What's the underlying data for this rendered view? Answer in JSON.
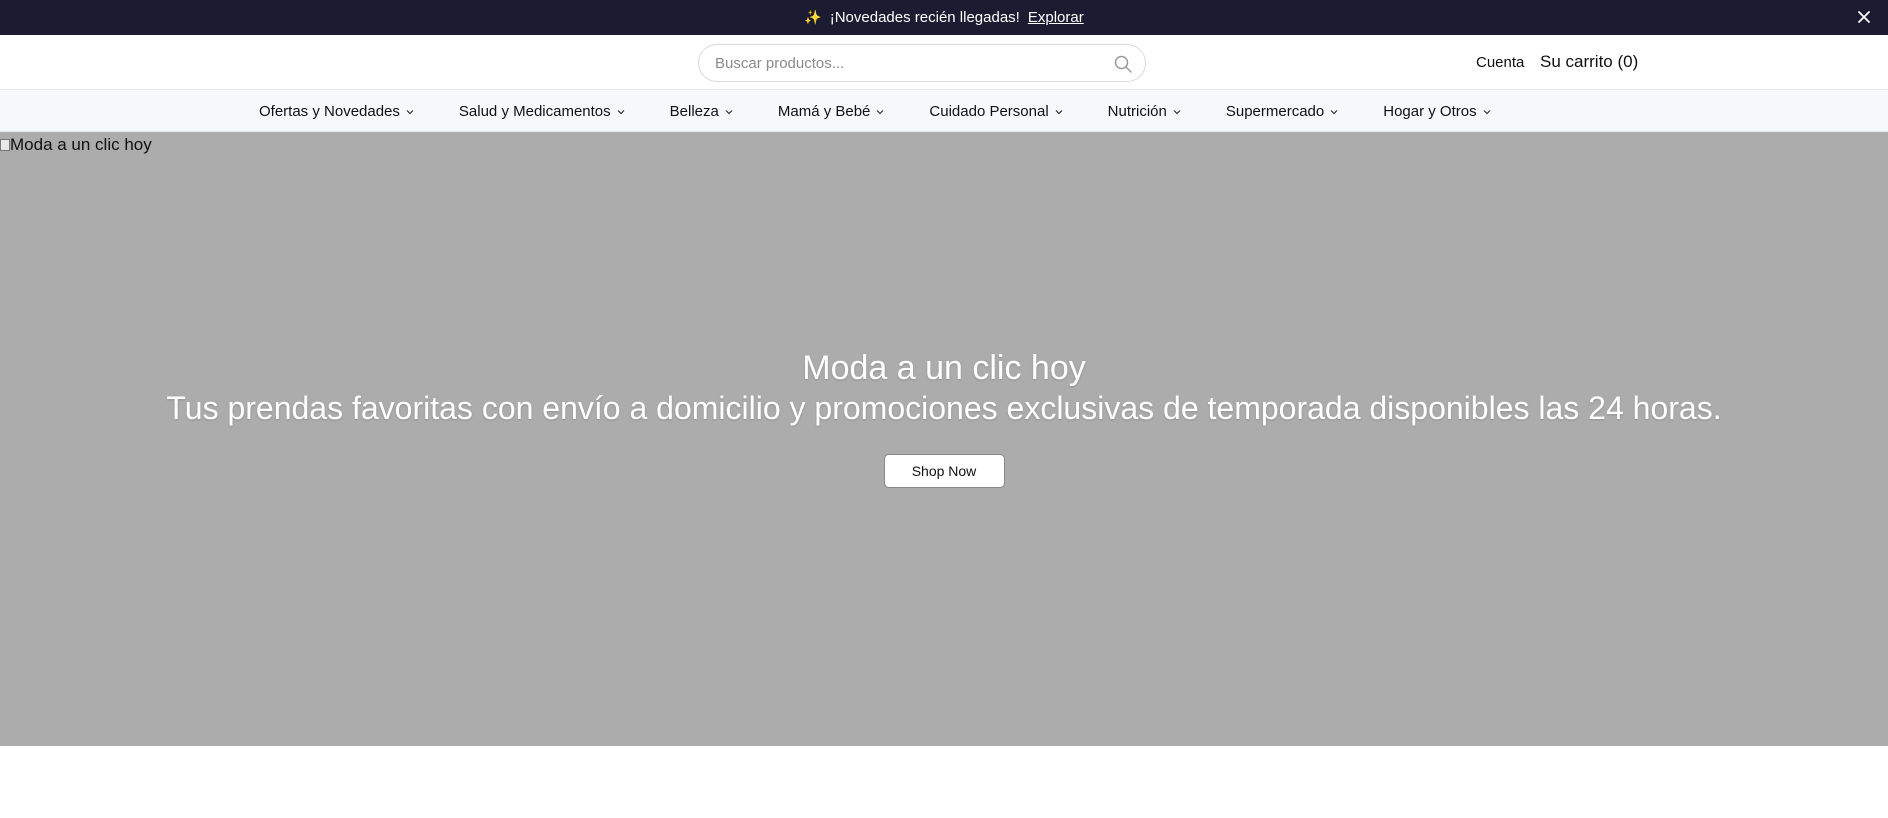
{
  "announcement": {
    "sparkle": "✨",
    "message": "¡Novedades recién llegadas!",
    "link_label": "Explorar"
  },
  "header": {
    "search_placeholder": "Buscar productos...",
    "account_label": "Cuenta",
    "cart_label": "Su carrito (0)"
  },
  "nav": {
    "items": [
      {
        "label": "Ofertas y Novedades"
      },
      {
        "label": "Salud y Medicamentos"
      },
      {
        "label": "Belleza"
      },
      {
        "label": "Mamá y Bebé"
      },
      {
        "label": "Cuidado Personal"
      },
      {
        "label": "Nutrición"
      },
      {
        "label": "Supermercado"
      },
      {
        "label": "Hogar y Otros"
      }
    ]
  },
  "hero": {
    "image_alt": "Moda a un clic hoy",
    "heading": "Moda a un clic hoy",
    "subheading": "Tus prendas favoritas con envío a domicilio y promociones exclusivas de temporada disponibles las 24 horas.",
    "cta_label": "Shop Now",
    "background_color": "#acacac"
  },
  "colors": {
    "announcement_bg": "#1b1b32",
    "nav_bg": "#f7f8fa"
  }
}
